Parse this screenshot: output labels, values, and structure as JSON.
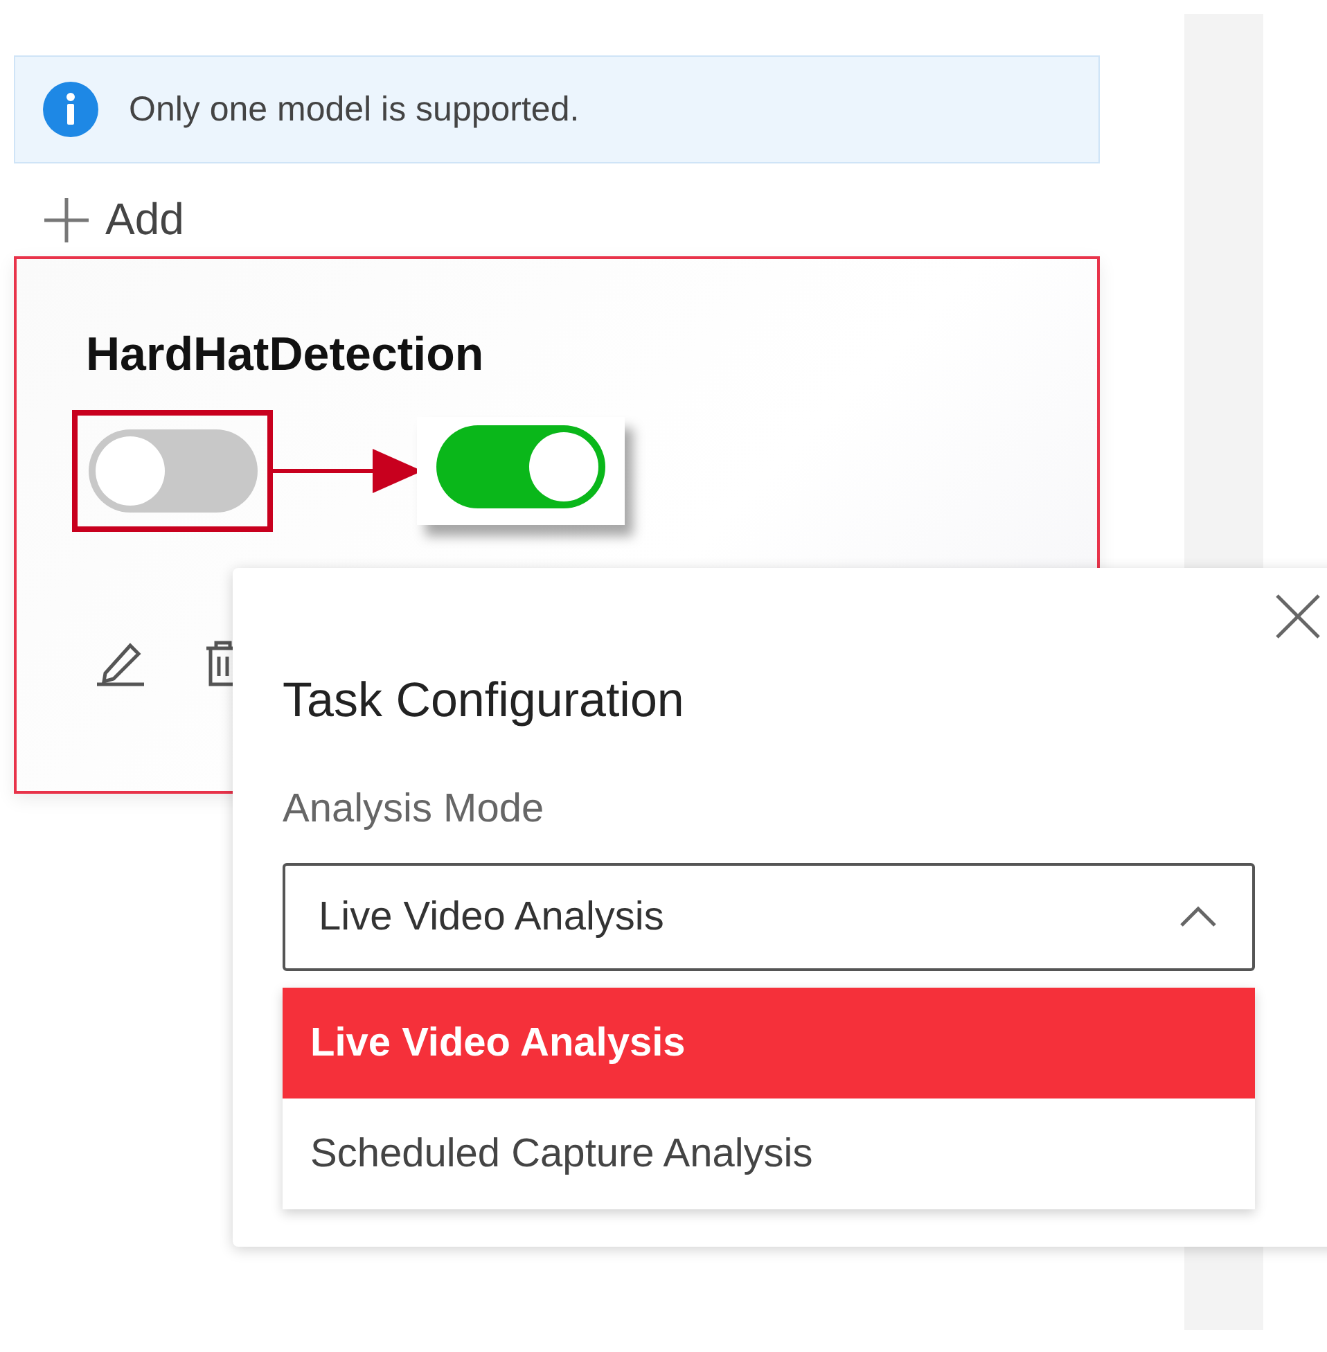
{
  "notice": {
    "text": "Only one model is supported."
  },
  "add_button": {
    "label": "Add"
  },
  "model_card": {
    "title": "HardHatDetection",
    "selected": true,
    "toggles": [
      {
        "on": false,
        "highlighted": true
      },
      {
        "on": true,
        "highlighted": false
      }
    ]
  },
  "dialog": {
    "title": "Task Configuration",
    "field_label": "Analysis Mode",
    "value": "Live Video Analysis",
    "expanded": true,
    "options": [
      {
        "label": "Live Video Analysis",
        "selected": true
      },
      {
        "label": "Scheduled Capture Analysis",
        "selected": false
      }
    ]
  }
}
